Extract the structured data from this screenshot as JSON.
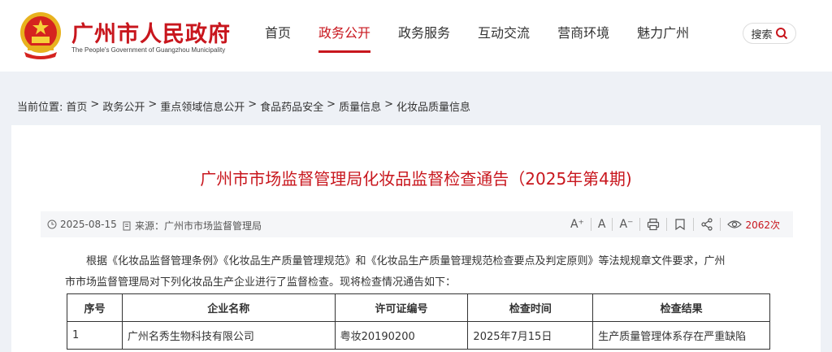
{
  "header": {
    "site_title": "广州市人民政府",
    "site_subtitle": "The People's Government of Guangzhou Municipality",
    "nav": [
      "首页",
      "政务公开",
      "政务服务",
      "互动交流",
      "营商环境",
      "魅力广州"
    ],
    "nav_active": "政务公开",
    "search_label": "搜索"
  },
  "breadcrumb": {
    "prefix": "当前位置:",
    "items": [
      "首页",
      "政务公开",
      "重点领域信息公开",
      "食品药品安全",
      "质量信息",
      "化妆品质量信息"
    ],
    "separator": ">"
  },
  "article": {
    "title": "广州市市场监督管理局化妆品监督检查通告（2025年第4期)",
    "date": "2025-08-15",
    "source": "来源：广州市市场监督管理局",
    "views": "2062次",
    "tools": [
      "A⁺",
      "A",
      "A⁻"
    ],
    "paragraph_line1": "根据《化妆品监督管理条例》《化妆品生产质量管理规范》和《化妆品生产质量管理规范检查要点及判定原则》等法规规章文件要求，广州",
    "paragraph_line2": "市市场监督管理局对下列化妆品生产企业进行了监督检查。现将检查情况通告如下："
  },
  "table": {
    "headers": [
      "序号",
      "企业名称",
      "许可证编号",
      "检查时间",
      "检查结果"
    ],
    "rows": [
      [
        "1",
        "广州名秀生物科技有限公司",
        "粤妆20190200",
        "2025年7月15日",
        "生产质量管理体系存在严重缺陷"
      ]
    ]
  },
  "colors": {
    "brand_red": "#c8161d",
    "page_bg": "#eef1f6"
  }
}
